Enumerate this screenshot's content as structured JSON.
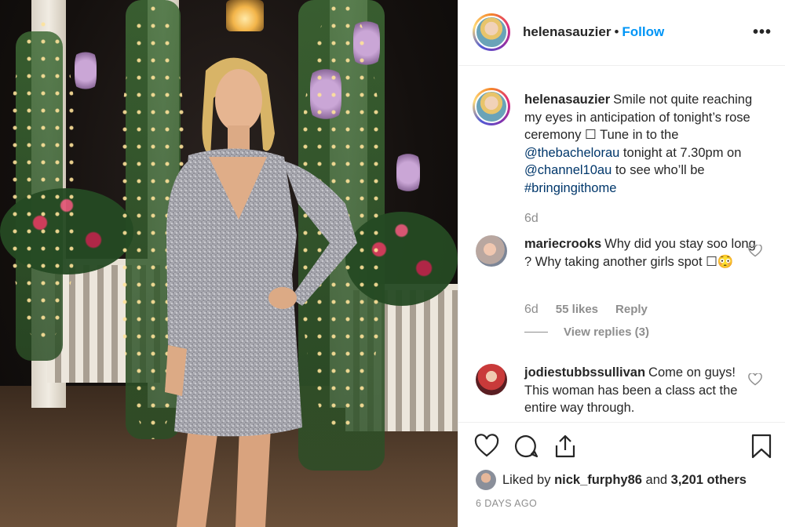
{
  "post": {
    "author": "helenasauzier",
    "follow_label": "Follow",
    "dot": "•",
    "more_label": "•••"
  },
  "caption": {
    "username": "helenasauzier",
    "text_before": "Smile not quite reaching my eyes in anticipation of tonight’s rose ceremony ☐ Tune in to the ",
    "mention1": "@thebachelorau",
    "text_mid": " tonight at 7.30pm on ",
    "mention2": "@channel10au",
    "text_after": " to see who’ll be ",
    "hashtag": "#bringingithome",
    "time": "6d"
  },
  "comments": [
    {
      "username": "mariecrooks",
      "text": "Why did you stay soo long ? Why taking another girls spot ☐😳",
      "time": "6d",
      "likes": "55 likes",
      "reply": "Reply",
      "view_replies": "View replies (3)"
    },
    {
      "username": "jodiestubbssullivan",
      "text": "Come on guys! This woman has been a class act the entire way through."
    }
  ],
  "likes": {
    "prefix": "Liked by",
    "user": "nick_furphy86",
    "and": "and",
    "others": "3,201 others"
  },
  "timestamp": "6 DAYS AGO",
  "icons": [
    "heart-icon",
    "comment-icon",
    "share-icon",
    "bookmark-icon",
    "more-icon"
  ]
}
